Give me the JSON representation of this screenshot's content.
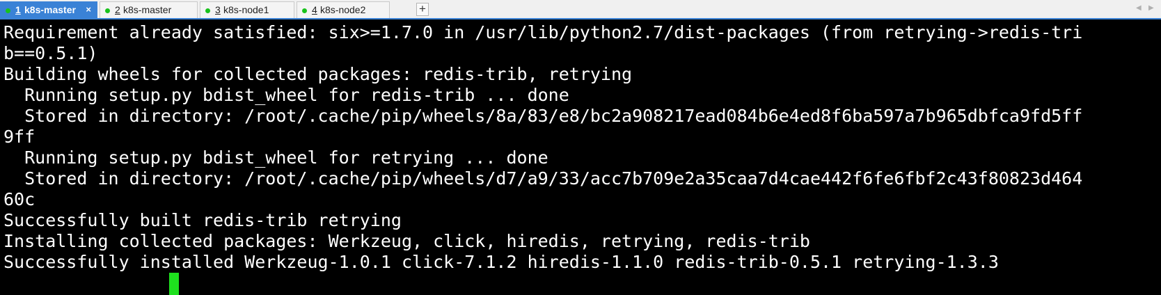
{
  "colors": {
    "active_tab": "#3a82d6",
    "status_dot": "#19c21c",
    "terminal_bg": "#000000",
    "terminal_fg": "#ffffff",
    "cursor": "#1ee01e"
  },
  "tabs": [
    {
      "number": "1",
      "label": "k8s-master",
      "active": true,
      "close": "×"
    },
    {
      "number": "2",
      "label": "k8s-master",
      "active": false
    },
    {
      "number": "3",
      "label": "k8s-node1",
      "active": false
    },
    {
      "number": "4",
      "label": "k8s-node2",
      "active": false
    }
  ],
  "toolbar": {
    "add_tab_label": "+",
    "scroll_left_label": "◀",
    "scroll_right_label": "▶"
  },
  "terminal": {
    "lines": [
      "Requirement already satisfied: six>=1.7.0 in /usr/lib/python2.7/dist-packages (from retrying->redis-tri",
      "b==0.5.1)",
      "Building wheels for collected packages: redis-trib, retrying",
      "  Running setup.py bdist_wheel for redis-trib ... done",
      "  Stored in directory: /root/.cache/pip/wheels/8a/83/e8/bc2a908217ead084b6e4ed8f6ba597a7b965dbfca9fd5ff",
      "9ff",
      "  Running setup.py bdist_wheel for retrying ... done",
      "  Stored in directory: /root/.cache/pip/wheels/d7/a9/33/acc7b709e2a35caa7d4cae442f6fe6fbf2c43f80823d464",
      "60c",
      "Successfully built redis-trib retrying",
      "Installing collected packages: Werkzeug, click, hiredis, retrying, redis-trib",
      "Successfully installed Werkzeug-1.0.1 click-7.1.2 hiredis-1.1.0 redis-trib-0.5.1 retrying-1.3.3"
    ]
  }
}
